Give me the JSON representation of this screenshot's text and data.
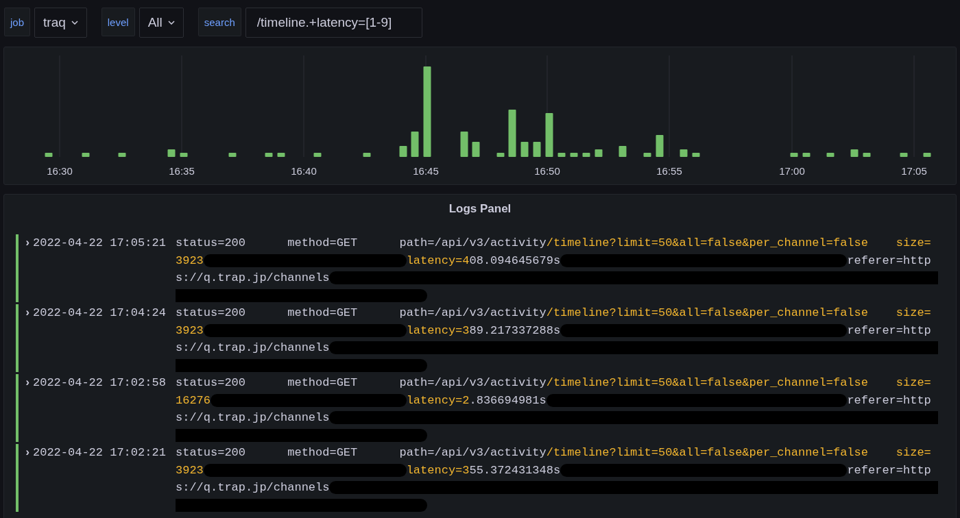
{
  "variables": [
    {
      "label": "job",
      "kind": "select",
      "value": "traq"
    },
    {
      "label": "level",
      "kind": "select",
      "value": "All"
    },
    {
      "label": "search",
      "kind": "text",
      "value": "/timeline.+latency=[1-9]"
    }
  ],
  "histogram": {
    "x_labels": [
      "16:30",
      "16:35",
      "16:40",
      "16:45",
      "16:50",
      "16:55",
      "17:00",
      "17:05"
    ]
  },
  "logs_panel": {
    "title": "Logs Panel",
    "rows": [
      {
        "expand": "›",
        "timestamp": "2022-04-22 17:05:21",
        "segments": [
          {
            "kind": "plain",
            "text": "status=200      method=GET      path=/api/v3/activity"
          },
          {
            "kind": "match",
            "text": "/timeline?limit=50&all=false&per_channel=false    size=3923"
          },
          {
            "kind": "redacted"
          },
          {
            "kind": "match",
            "text": "latency=4"
          },
          {
            "kind": "plain",
            "text": "08.094645679s"
          },
          {
            "kind": "redacted"
          },
          {
            "kind": "plain",
            "text": "referer=https://q.trap.jp/channels"
          },
          {
            "kind": "redacted"
          }
        ]
      },
      {
        "expand": "›",
        "timestamp": "2022-04-22 17:04:24",
        "segments": [
          {
            "kind": "plain",
            "text": "status=200      method=GET      path=/api/v3/activity"
          },
          {
            "kind": "match",
            "text": "/timeline?limit=50&all=false&per_channel=false    size=3923"
          },
          {
            "kind": "redacted"
          },
          {
            "kind": "match",
            "text": "latency=3"
          },
          {
            "kind": "plain",
            "text": "89.217337288s"
          },
          {
            "kind": "redacted"
          },
          {
            "kind": "plain",
            "text": "referer=https://q.trap.jp/channels"
          },
          {
            "kind": "redacted"
          }
        ]
      },
      {
        "expand": "›",
        "timestamp": "2022-04-22 17:02:58",
        "segments": [
          {
            "kind": "plain",
            "text": "status=200      method=GET      path=/api/v3/activity"
          },
          {
            "kind": "match",
            "text": "/timeline?limit=50&all=false&per_channel=false    size=16276"
          },
          {
            "kind": "redacted"
          },
          {
            "kind": "match",
            "text": "latency=2"
          },
          {
            "kind": "plain",
            "text": ".836694981s"
          },
          {
            "kind": "redacted"
          },
          {
            "kind": "plain",
            "text": "referer=https://q.trap.jp/channels"
          },
          {
            "kind": "redacted"
          }
        ]
      },
      {
        "expand": "›",
        "timestamp": "2022-04-22 17:02:21",
        "segments": [
          {
            "kind": "plain",
            "text": "status=200      method=GET      path=/api/v3/activity"
          },
          {
            "kind": "match",
            "text": "/timeline?limit=50&all=false&per_channel=false    size=3923"
          },
          {
            "kind": "redacted"
          },
          {
            "kind": "match",
            "text": "latency=3"
          },
          {
            "kind": "plain",
            "text": "55.372431348s"
          },
          {
            "kind": "redacted"
          },
          {
            "kind": "plain",
            "text": "referer=https://q.trap.jp/channels"
          },
          {
            "kind": "redacted"
          }
        ]
      }
    ]
  }
}
